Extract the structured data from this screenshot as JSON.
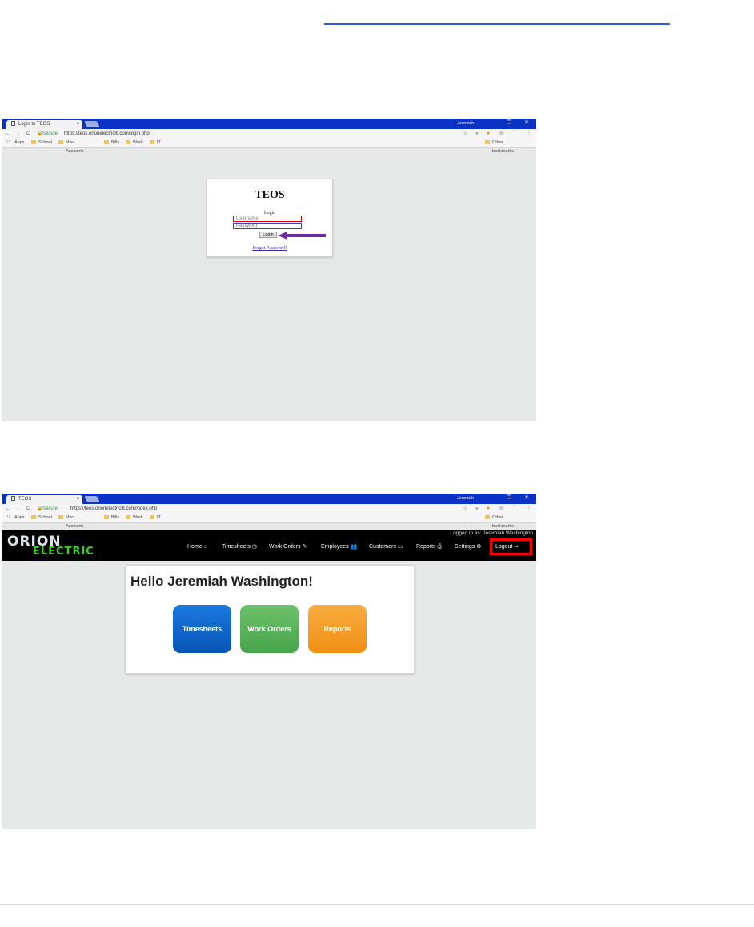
{
  "colors": {
    "chrome": "#0a32c4",
    "highlight_red": "#ff0000",
    "arrow_purple": "#6a2da3",
    "electric_green": "#39d11e"
  },
  "chrome": {
    "user": "Jeremiah",
    "bookmarks": [
      "Apps",
      "School",
      "Misc Accounts",
      "Bills",
      "Work",
      "IT"
    ],
    "other_bookmarks": "Other bookmarks",
    "secure": "Secure"
  },
  "shot1": {
    "tab_title": "Login to TEOS",
    "url": "https://teos.orionelectricltl.com/login.php",
    "login": {
      "title": "TEOS",
      "label": "Login",
      "username_placeholder": "Username",
      "password_placeholder": "Password",
      "button": "Login",
      "forgot": "Forgot Password?"
    }
  },
  "shot2": {
    "tab_title": "TEOS",
    "url": "https://teos.orionelectricltl.com/index.php",
    "logo_top": "ORION",
    "logo_bottom": "ELECTRIC",
    "logged_in": "Logged in as: Jeremiah Washington",
    "nav": {
      "home": "Home",
      "timesheets": "Timesheets",
      "workorders": "Work Orders",
      "employees": "Employees",
      "customers": "Customers",
      "reports": "Reports",
      "settings": "Settings",
      "logout": "Logout"
    },
    "greeting": "Hello Jeremiah Washington!",
    "tiles": {
      "timesheets": "Timesheets",
      "workorders": "Work Orders",
      "reports": "Reports"
    }
  }
}
